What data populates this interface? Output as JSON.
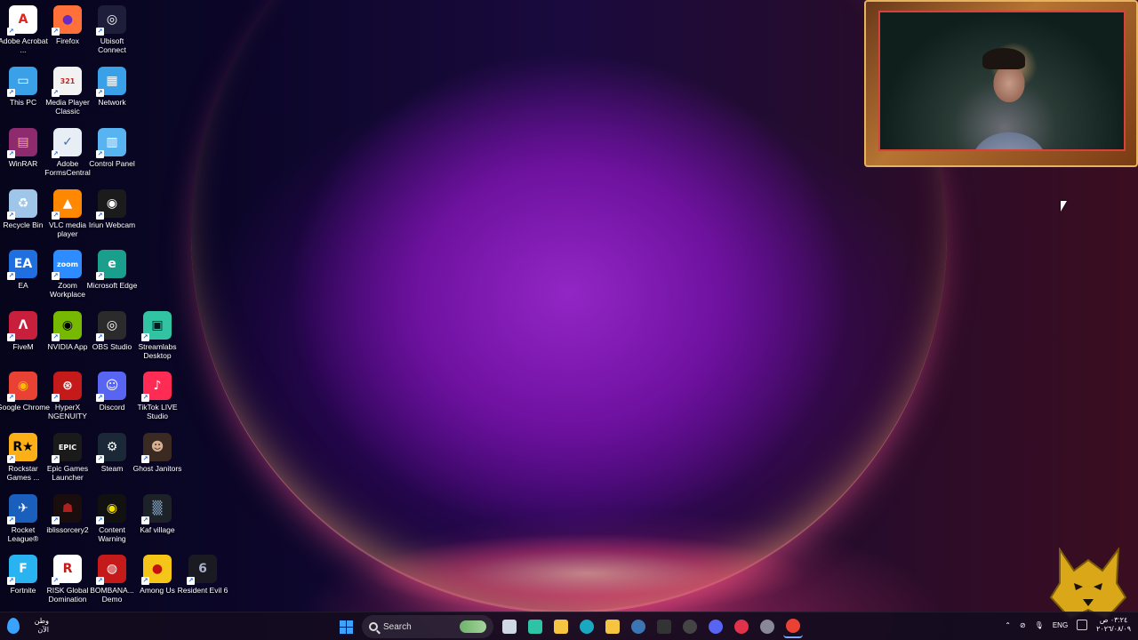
{
  "desktop": {
    "icons": [
      {
        "label": "Adobe Acrobat ...",
        "icon": "acrobat-icon",
        "color": "#ffffff",
        "glyph": "A",
        "fg": "#e2231a"
      },
      {
        "label": "Firefox",
        "icon": "firefox-icon",
        "color": "#ff7139",
        "glyph": "●",
        "fg": "#6a2bc2"
      },
      {
        "label": "Ubisoft Connect",
        "icon": "ubisoft-icon",
        "color": "#1e1e3a",
        "glyph": "◎",
        "fg": "#ffffff"
      },
      {
        "label": "This PC",
        "icon": "this-pc-icon",
        "color": "#3aa0e8",
        "glyph": "▭",
        "fg": "#ffffff"
      },
      {
        "label": "Media Player Classic",
        "icon": "mpc-icon",
        "color": "#f2f2f2",
        "glyph": "321",
        "fg": "#d02020"
      },
      {
        "label": "Network",
        "icon": "network-icon",
        "color": "#3aa0e8",
        "glyph": "▦",
        "fg": "#ffffff"
      },
      {
        "label": "WinRAR",
        "icon": "winrar-icon",
        "color": "#8e2a6e",
        "glyph": "▤",
        "fg": "#f0c040"
      },
      {
        "label": "Adobe FormsCentral",
        "icon": "forms-central-icon",
        "color": "#e8eef5",
        "glyph": "✓",
        "fg": "#4a6ea8"
      },
      {
        "label": "Control Panel",
        "icon": "control-panel-icon",
        "color": "#58b4f0",
        "glyph": "▥",
        "fg": "#ffffff"
      },
      {
        "label": "Recycle Bin",
        "icon": "recycle-bin-icon",
        "color": "#9fc6e8",
        "glyph": "♻",
        "fg": "#ffffff"
      },
      {
        "label": "VLC media player",
        "icon": "vlc-icon",
        "color": "#ff8800",
        "glyph": "▲",
        "fg": "#ffffff"
      },
      {
        "label": "Iriun Webcam",
        "icon": "iriun-webcam-icon",
        "color": "#1b1b1b",
        "glyph": "◉",
        "fg": "#ffffff"
      },
      {
        "label": "EA",
        "icon": "ea-icon",
        "color": "#1f6fe0",
        "glyph": "EA",
        "fg": "#ffffff"
      },
      {
        "label": "Zoom Workplace",
        "icon": "zoom-icon",
        "color": "#2d8cff",
        "glyph": "zoom",
        "fg": "#ffffff"
      },
      {
        "label": "Microsoft Edge",
        "icon": "edge-icon",
        "color": "#1a9f8c",
        "glyph": "e",
        "fg": "#ffffff"
      },
      {
        "label": "FiveM",
        "icon": "fivem-icon",
        "color": "#c81f3d",
        "glyph": "Λ",
        "fg": "#ffffff"
      },
      {
        "label": "NVIDIA App",
        "icon": "nvidia-icon",
        "color": "#76b900",
        "glyph": "◉",
        "fg": "#000000"
      },
      {
        "label": "OBS Studio",
        "icon": "obs-icon",
        "color": "#2b2b2b",
        "glyph": "◎",
        "fg": "#ffffff"
      },
      {
        "label": "Streamlabs Desktop",
        "icon": "streamlabs-icon",
        "color": "#31c3a2",
        "glyph": "▣",
        "fg": "#09161d"
      },
      {
        "label": "Google Chrome",
        "icon": "chrome-icon",
        "color": "#e94235",
        "glyph": "◉",
        "fg": "#fbbc04"
      },
      {
        "label": "HyperX NGENUITY",
        "icon": "hyperx-icon",
        "color": "#c41a1a",
        "glyph": "⊛",
        "fg": "#ffffff"
      },
      {
        "label": "Discord",
        "icon": "discord-icon",
        "color": "#5865f2",
        "glyph": "☺",
        "fg": "#ffffff"
      },
      {
        "label": "TikTok LIVE Studio",
        "icon": "tiktok-live-icon",
        "color": "#fe2c55",
        "glyph": "♪",
        "fg": "#ffffff"
      },
      {
        "label": "Rockstar Games ...",
        "icon": "rockstar-icon",
        "color": "#fcaf17",
        "glyph": "R★",
        "fg": "#000000"
      },
      {
        "label": "Epic Games Launcher",
        "icon": "epic-icon",
        "color": "#1a1a1a",
        "glyph": "EPIC",
        "fg": "#ffffff"
      },
      {
        "label": "Steam",
        "icon": "steam-icon",
        "color": "#1b2838",
        "glyph": "⚙",
        "fg": "#ffffff"
      },
      {
        "label": "Ghost Janitors",
        "icon": "ghost-janitors-icon",
        "color": "#3a2a22",
        "glyph": "☻",
        "fg": "#d8b090"
      },
      {
        "label": "Rocket League®",
        "icon": "rocket-league-icon",
        "color": "#1b5fbd",
        "glyph": "✈",
        "fg": "#ffffff"
      },
      {
        "label": "iblissorcery2",
        "icon": "iblissorcery-icon",
        "color": "#1a0d0d",
        "glyph": "☗",
        "fg": "#b02020"
      },
      {
        "label": "Content Warning",
        "icon": "content-warning-icon",
        "color": "#111111",
        "glyph": "◉",
        "fg": "#f3e000"
      },
      {
        "label": "Kaf village",
        "icon": "kaf-village-icon",
        "color": "#1c2228",
        "glyph": "▒",
        "fg": "#88aacc"
      },
      {
        "label": "Fortnite",
        "icon": "fortnite-icon",
        "color": "#29b3f0",
        "glyph": "F",
        "fg": "#ffffff"
      },
      {
        "label": "RISK Global Domination",
        "icon": "risk-icon",
        "color": "#ffffff",
        "glyph": "R",
        "fg": "#c41a1a"
      },
      {
        "label": "BOMBANA... Demo",
        "icon": "bombana-icon",
        "color": "#c41a1a",
        "glyph": "◍",
        "fg": "#ffffff"
      },
      {
        "label": "Among Us",
        "icon": "among-us-icon",
        "color": "#f5c518",
        "glyph": "●",
        "fg": "#c51111"
      },
      {
        "label": "Resident Evil 6",
        "icon": "resident-evil-icon",
        "color": "#1a1a22",
        "glyph": "6",
        "fg": "#aab0c8"
      }
    ]
  },
  "taskbar": {
    "weather_text": "وطن الآن",
    "search_label": "Search",
    "apps": [
      {
        "name": "task-view-button",
        "color": "#cfd6e4"
      },
      {
        "name": "copilot-button",
        "color": "#2ec3a6"
      },
      {
        "name": "file-explorer-button",
        "color": "#f5c542"
      },
      {
        "name": "edge-taskbar-button",
        "color": "#1aa7c0"
      },
      {
        "name": "store-button",
        "color": "#f5c542"
      },
      {
        "name": "steam-taskbar-button",
        "color": "#3b76b3"
      },
      {
        "name": "epic-taskbar-button",
        "color": "#333333"
      },
      {
        "name": "obs-taskbar-button",
        "color": "#444444"
      },
      {
        "name": "discord-taskbar-button",
        "color": "#5865f2"
      },
      {
        "name": "opera-taskbar-button",
        "color": "#e0324b"
      },
      {
        "name": "settings-taskbar-button",
        "color": "#888899"
      },
      {
        "name": "chrome-taskbar-button",
        "color": "#e94235"
      }
    ],
    "language": "ENG",
    "time": "٠٣:٢٤ ص",
    "date": "٢٠٢٦/٠٨/٠٩"
  }
}
